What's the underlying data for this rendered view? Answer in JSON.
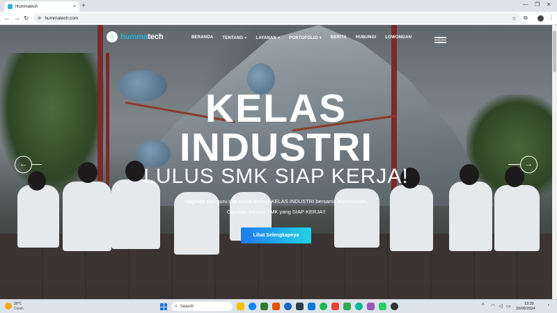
{
  "browser": {
    "tab_title": "Hummatech",
    "tab_close": "×",
    "new_tab": "+",
    "url": "hummatech.com",
    "window_min": "—",
    "window_max": "❐",
    "window_close": "✕",
    "back": "←",
    "forward": "→",
    "reload": "↻",
    "star": "☆",
    "extensions": "⧉",
    "menu": "⋮"
  },
  "site": {
    "logo_part1": "humma",
    "logo_part2": "tech",
    "nav": [
      "BERANDA",
      "TENTANG ▾",
      "LAYANAN ▾",
      "PORTOFOLIO ▾",
      "BERITA",
      "HUBUNGI",
      "LOWONGAN"
    ]
  },
  "hero": {
    "line1": "KELAS",
    "line2": "INDUSTRI",
    "line3": "LULUS SMK SIAP KERJA!",
    "desc1": "Upgrade skill guru dan siswa melalui KELAS INDUSTRI bersama Hummatech.",
    "desc2": "Ciptakan lulusan SMK yang SIAP KERJA!!",
    "cta": "Lihat Selengkapnya",
    "prev_arrow": "←",
    "next_arrow": "→"
  },
  "taskbar": {
    "temp": "29°C",
    "condition": "Cerah",
    "search_placeholder": "Search",
    "time": "13:30",
    "date": "20/06/2024",
    "icon_colors": [
      "#f2c200",
      "#0a84ff",
      "#2e7d32",
      "#e65100",
      "#1565c0",
      "#2c3e50",
      "#0078d4",
      "#1db954",
      "#ea4335",
      "#34a853",
      "#00b894",
      "#9b59b6",
      "#25d366",
      "#333333"
    ]
  },
  "colors": {
    "brand": "#29b6d8",
    "cta_start": "#1f7af0",
    "cta_end": "#22d3e6"
  }
}
